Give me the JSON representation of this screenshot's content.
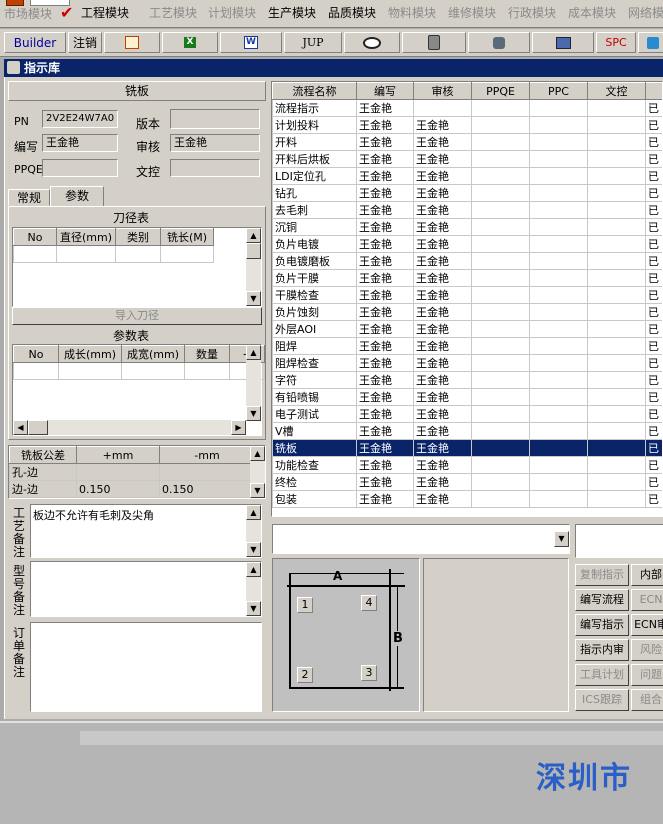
{
  "menu": {
    "items": [
      {
        "label": "市场模块",
        "dim": true
      },
      {
        "label": "工程模块",
        "dim": false
      },
      {
        "label": "工艺模块",
        "dim": true
      },
      {
        "label": "计划模块",
        "dim": true
      },
      {
        "label": "生产模块",
        "dim": false
      },
      {
        "label": "品质模块",
        "dim": false
      },
      {
        "label": "物料模块",
        "dim": true
      },
      {
        "label": "维修模块",
        "dim": true
      },
      {
        "label": "行政模块",
        "dim": true
      },
      {
        "label": "成本模块",
        "dim": true
      },
      {
        "label": "网络模",
        "dim": true
      }
    ]
  },
  "toolbar": {
    "builder_label": "Builder",
    "logout_label": "注销",
    "jup_label": "JUP",
    "spc_label": "SPC"
  },
  "window": {
    "title": "指示库"
  },
  "left": {
    "header": "铣板",
    "pn_label": "PN",
    "pn_value": "2V2E24W7A0",
    "version_label": "版本",
    "version_value": "",
    "author_label": "编写",
    "author_value": "王金艳",
    "review_label": "审核",
    "review_value": "王金艳",
    "ppqe_label": "PPQE",
    "ppqe_value": "",
    "doc_label": "文控",
    "doc_value": "",
    "tabs": [
      "常规",
      "参数"
    ],
    "tool_table_title": "刀径表",
    "tool_cols": [
      "No",
      "直径(mm)",
      "类别",
      "铣长(M)"
    ],
    "import_button": "导入刀径",
    "param_table_title": "参数表",
    "param_cols": [
      "No",
      "成长(mm)",
      "成宽(mm)",
      "数量",
      "+"
    ],
    "tolerance": {
      "cols": [
        "铣板公差",
        "+mm",
        "-mm"
      ],
      "rows": [
        {
          "name": "孔-边",
          "plus": "",
          "minus": ""
        },
        {
          "name": "边-边",
          "plus": "0.150",
          "minus": "0.150"
        }
      ]
    },
    "process_note_label": "工艺备注",
    "process_note_value": "板边不允许有毛刺及尖角",
    "model_note_label": "型号备注",
    "order_note_label": "订单备注"
  },
  "grid": {
    "cols": [
      "流程名称",
      "编写",
      "审核",
      "PPQE",
      "PPC",
      "文控"
    ],
    "rows": [
      {
        "name": "流程指示",
        "author": "王金艳",
        "review": "",
        "ppqe": "",
        "ppc": "",
        "doc": "",
        "status": "已"
      },
      {
        "name": "计划投料",
        "author": "王金艳",
        "review": "王金艳",
        "ppqe": "",
        "ppc": "",
        "doc": "",
        "status": "已"
      },
      {
        "name": "开料",
        "author": "王金艳",
        "review": "王金艳",
        "ppqe": "",
        "ppc": "",
        "doc": "",
        "status": "已"
      },
      {
        "name": "开料后烘板",
        "author": "王金艳",
        "review": "王金艳",
        "ppqe": "",
        "ppc": "",
        "doc": "",
        "status": "已"
      },
      {
        "name": "LDI定位孔",
        "author": "王金艳",
        "review": "王金艳",
        "ppqe": "",
        "ppc": "",
        "doc": "",
        "status": "已"
      },
      {
        "name": "钻孔",
        "author": "王金艳",
        "review": "王金艳",
        "ppqe": "",
        "ppc": "",
        "doc": "",
        "status": "已"
      },
      {
        "name": "去毛刺",
        "author": "王金艳",
        "review": "王金艳",
        "ppqe": "",
        "ppc": "",
        "doc": "",
        "status": "已"
      },
      {
        "name": "沉铜",
        "author": "王金艳",
        "review": "王金艳",
        "ppqe": "",
        "ppc": "",
        "doc": "",
        "status": "已"
      },
      {
        "name": "负片电镀",
        "author": "王金艳",
        "review": "王金艳",
        "ppqe": "",
        "ppc": "",
        "doc": "",
        "status": "已"
      },
      {
        "name": "负电镀磨板",
        "author": "王金艳",
        "review": "王金艳",
        "ppqe": "",
        "ppc": "",
        "doc": "",
        "status": "已"
      },
      {
        "name": "负片干膜",
        "author": "王金艳",
        "review": "王金艳",
        "ppqe": "",
        "ppc": "",
        "doc": "",
        "status": "已"
      },
      {
        "name": "干膜检查",
        "author": "王金艳",
        "review": "王金艳",
        "ppqe": "",
        "ppc": "",
        "doc": "",
        "status": "已"
      },
      {
        "name": "负片蚀刻",
        "author": "王金艳",
        "review": "王金艳",
        "ppqe": "",
        "ppc": "",
        "doc": "",
        "status": "已"
      },
      {
        "name": "外层AOI",
        "author": "王金艳",
        "review": "王金艳",
        "ppqe": "",
        "ppc": "",
        "doc": "",
        "status": "已"
      },
      {
        "name": "阻焊",
        "author": "王金艳",
        "review": "王金艳",
        "ppqe": "",
        "ppc": "",
        "doc": "",
        "status": "已"
      },
      {
        "name": "阻焊检查",
        "author": "王金艳",
        "review": "王金艳",
        "ppqe": "",
        "ppc": "",
        "doc": "",
        "status": "已"
      },
      {
        "name": "字符",
        "author": "王金艳",
        "review": "王金艳",
        "ppqe": "",
        "ppc": "",
        "doc": "",
        "status": "已"
      },
      {
        "name": "有铅喷锡",
        "author": "王金艳",
        "review": "王金艳",
        "ppqe": "",
        "ppc": "",
        "doc": "",
        "status": "已"
      },
      {
        "name": "电子测试",
        "author": "王金艳",
        "review": "王金艳",
        "ppqe": "",
        "ppc": "",
        "doc": "",
        "status": "已"
      },
      {
        "name": "V槽",
        "author": "王金艳",
        "review": "王金艳",
        "ppqe": "",
        "ppc": "",
        "doc": "",
        "status": "已"
      },
      {
        "name": "铣板",
        "author": "王金艳",
        "review": "王金艳",
        "ppqe": "",
        "ppc": "",
        "doc": "",
        "status": "已"
      },
      {
        "name": "功能检查",
        "author": "王金艳",
        "review": "王金艳",
        "ppqe": "",
        "ppc": "",
        "doc": "",
        "status": "已"
      },
      {
        "name": "终检",
        "author": "王金艳",
        "review": "王金艳",
        "ppqe": "",
        "ppc": "",
        "doc": "",
        "status": "已"
      },
      {
        "name": "包装",
        "author": "王金艳",
        "review": "王金艳",
        "ppqe": "",
        "ppc": "",
        "doc": "",
        "status": "已"
      }
    ],
    "selected_index": 20
  },
  "diagram": {
    "a": "A",
    "b": "B",
    "n1": "1",
    "n2": "2",
    "n3": "3",
    "n4": "4"
  },
  "buttons": [
    {
      "label": "复制指示",
      "dim": true
    },
    {
      "label": "内部",
      "dim": false
    },
    {
      "label": "编写流程",
      "dim": false
    },
    {
      "label": "ECN",
      "dim": true
    },
    {
      "label": "编写指示",
      "dim": false
    },
    {
      "label": "ECN审",
      "dim": false
    },
    {
      "label": "指示内审",
      "dim": false
    },
    {
      "label": "风险",
      "dim": true
    },
    {
      "label": "工具计划",
      "dim": true
    },
    {
      "label": "问题",
      "dim": true
    },
    {
      "label": "ICS跟踪",
      "dim": true
    },
    {
      "label": "组合",
      "dim": true
    }
  ],
  "watermark": "深圳市"
}
